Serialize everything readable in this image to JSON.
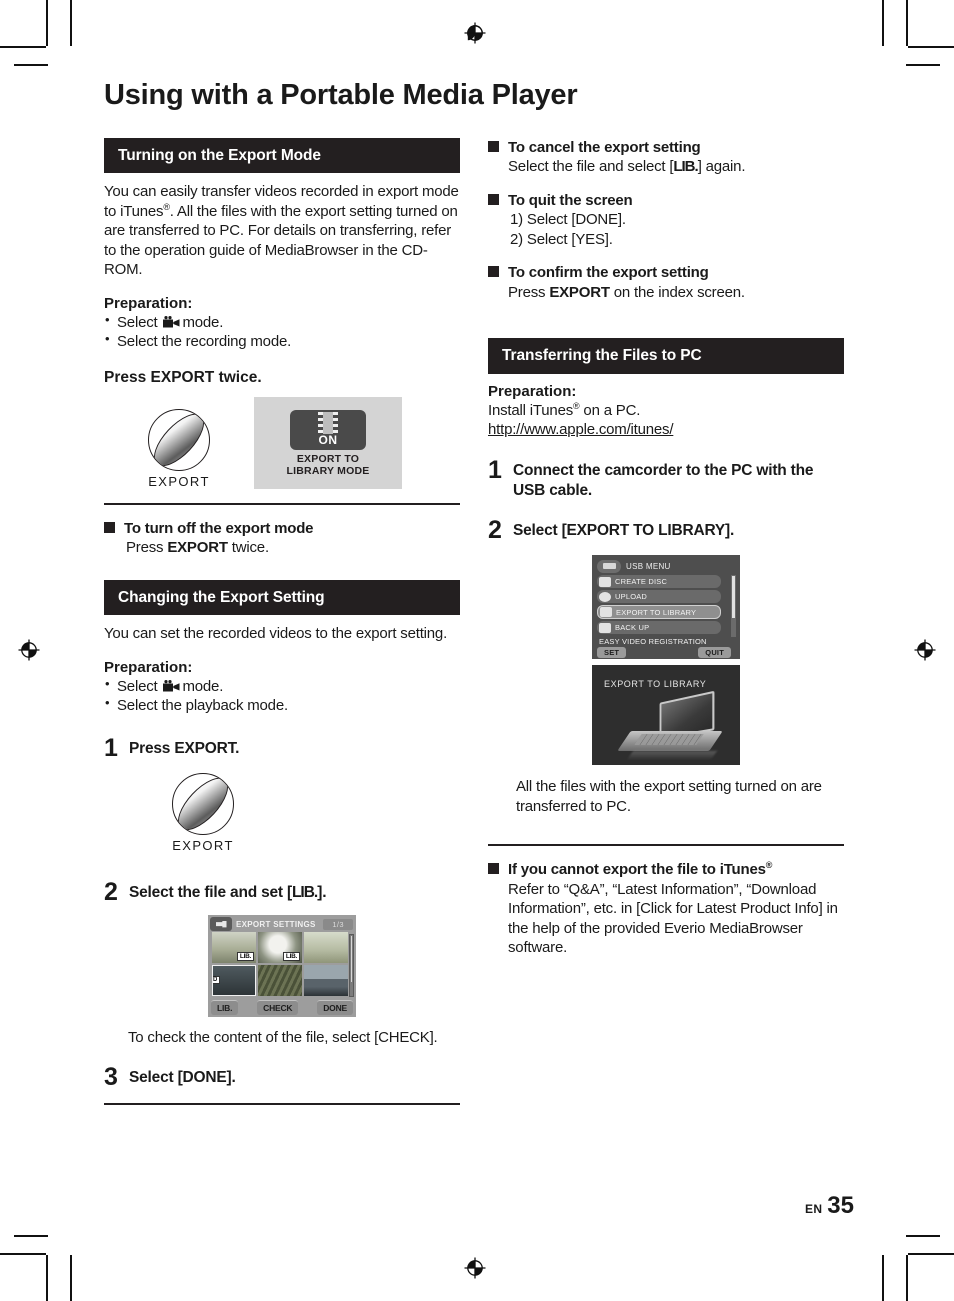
{
  "page": {
    "title": "Using with a Portable Media Player",
    "footer_locale": "EN",
    "footer_page": "35"
  },
  "left_column": {
    "section1": {
      "heading": "Turning on the Export Mode",
      "intro": "You can easily transfer videos recorded in export mode to iTunes®. All the files with the export setting turned on are transferred to PC. For details on transferring, refer to the operation guide of MediaBrowser in the CD-ROM.",
      "prep_label": "Preparation:",
      "prep_items": [
        "Select   mode.",
        "Select the recording mode."
      ],
      "prep_item1_prefix": "Select",
      "prep_item1_suffix": "mode.",
      "press_line": "Press EXPORT twice.",
      "export_button_label": "EXPORT",
      "mode_panel": {
        "state": "ON",
        "caption_line1": "EXPORT TO",
        "caption_line2": "LIBRARY MODE"
      },
      "turn_off_heading": "To turn off the export mode",
      "turn_off_body_pre": "Press",
      "turn_off_body_bold": "EXPORT",
      "turn_off_body_post": "twice."
    },
    "section2": {
      "heading": "Changing the Export Setting",
      "intro": "You can set the recorded videos to the export setting.",
      "prep_label": "Preparation:",
      "prep_item1_prefix": "Select",
      "prep_item1_suffix": "mode.",
      "prep_item2": "Select the playback mode.",
      "step1_num": "1",
      "step1_text": "Press EXPORT.",
      "export_button_label": "EXPORT",
      "step2_num": "2",
      "step2_text_pre": "Select the file and set [",
      "step2_text_lib": "LIB.",
      "step2_text_post": "].",
      "export_settings_screen": {
        "title": "EXPORT SETTINGS",
        "page_counter": "1/3",
        "thumb_badges": [
          "LIB.",
          "LIB."
        ],
        "sd_badge": "SD",
        "buttons": [
          "LIB.",
          "CHECK",
          "DONE"
        ]
      },
      "check_note": "To check the content of the file, select [CHECK].",
      "step3_num": "3",
      "step3_text": "Select [DONE]."
    }
  },
  "right_column": {
    "cancel_block": {
      "heading": "To cancel the export setting",
      "body_pre": "Select the file and select [",
      "body_lib": "LIB.",
      "body_post": "] again."
    },
    "quit_block": {
      "heading": "To quit the screen",
      "items": [
        "1) Select [DONE].",
        "2) Select [YES]."
      ]
    },
    "confirm_block": {
      "heading": "To confirm the export setting",
      "body_pre": "Press",
      "body_bold": "EXPORT",
      "body_post": "on the index screen."
    },
    "section3": {
      "heading": "Transferring the Files to PC",
      "prep_label": "Preparation:",
      "prep_line": "Install iTunes® on a PC.",
      "prep_url": "http://www.apple.com/itunes/",
      "step1_num": "1",
      "step1_text": "Connect the camcorder to the PC with the USB cable.",
      "step2_num": "2",
      "step2_text": "Select [EXPORT TO LIBRARY].",
      "usb_menu_screen": {
        "title": "USB MENU",
        "items": [
          "CREATE DISC",
          "UPLOAD",
          "EXPORT TO LIBRARY",
          "BACK UP"
        ],
        "selected_item": "EXPORT TO LIBRARY",
        "note": "EASY VIDEO REGISTRATION",
        "button_left": "SET",
        "button_right": "QUIT"
      },
      "library_screen": {
        "title": "EXPORT TO LIBRARY"
      },
      "after_note": "All the files with the export setting turned on are transferred to PC."
    },
    "trouble_block": {
      "heading": "If you cannot export the file to iTunes®",
      "body": "Refer to “Q&A”, “Latest Information”, “Download Information”, etc. in [Click for Latest Product Info] in the help of the provided Everio MediaBrowser software."
    }
  }
}
